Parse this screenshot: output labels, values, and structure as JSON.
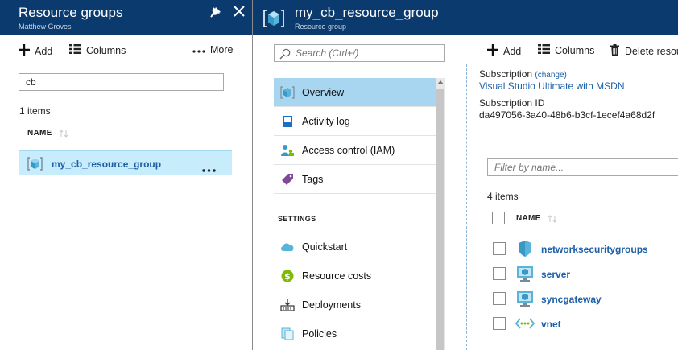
{
  "left_blade": {
    "title": "Resource groups",
    "subtitle": "Matthew Groves",
    "toolbar": {
      "add": "Add",
      "columns": "Columns",
      "more": "More"
    },
    "filter_value": "cb",
    "count": "1 items",
    "column_header": "NAME",
    "rows": [
      {
        "name": "my_cb_resource_group"
      }
    ]
  },
  "right_blade": {
    "title": "my_cb_resource_group",
    "subtitle": "Resource group",
    "search_placeholder": "Search (Ctrl+/)",
    "menu": {
      "items": [
        {
          "label": "Overview",
          "icon": "overview-icon"
        },
        {
          "label": "Activity log",
          "icon": "activity-log-icon"
        },
        {
          "label": "Access control (IAM)",
          "icon": "iam-icon"
        },
        {
          "label": "Tags",
          "icon": "tag-icon"
        }
      ],
      "settings_header": "SETTINGS",
      "settings_items": [
        {
          "label": "Quickstart",
          "icon": "quickstart-icon"
        },
        {
          "label": "Resource costs",
          "icon": "cost-icon"
        },
        {
          "label": "Deployments",
          "icon": "deployments-icon"
        },
        {
          "label": "Policies",
          "icon": "policies-icon"
        }
      ]
    },
    "toolbar": {
      "add": "Add",
      "columns": "Columns",
      "delete": "Delete resou"
    },
    "subscription_label": "Subscription",
    "subscription_change": "(change)",
    "subscription_value": "Visual Studio Ultimate with MSDN",
    "subscription_id_label": "Subscription ID",
    "subscription_id_value": "da497056-3a40-48b6-b3cf-1ecef4a68d2f",
    "filter_placeholder": "Filter by name...",
    "count": "4 items",
    "column_header": "NAME",
    "resources": [
      {
        "name": "networksecuritygroups",
        "icon": "shield-icon"
      },
      {
        "name": "server",
        "icon": "vm-icon"
      },
      {
        "name": "syncgateway",
        "icon": "vm-icon"
      },
      {
        "name": "vnet",
        "icon": "vnet-icon"
      }
    ]
  },
  "colors": {
    "header_bg": "#0b3b6e",
    "selected_row": "#c7ecfb",
    "active_menu": "#a8d6f0",
    "link": "#1e5fa8"
  }
}
